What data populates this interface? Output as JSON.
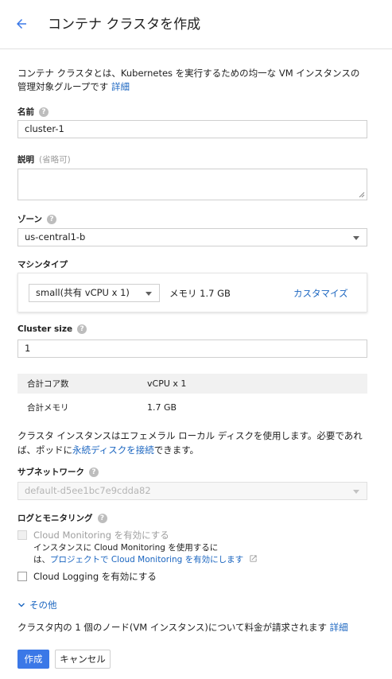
{
  "header": {
    "title": "コンテナ クラスタを作成"
  },
  "intro": {
    "text": "コンテナ クラスタとは、Kubernetes を実行するための均一な VM インスタンスの管理対象グループです ",
    "link": "詳細"
  },
  "name": {
    "label": "名前",
    "value": "cluster-1"
  },
  "description": {
    "label": "説明",
    "optional": "(省略可)",
    "value": ""
  },
  "zone": {
    "label": "ゾーン",
    "value": "us-central1-b"
  },
  "machine_type": {
    "label": "マシンタイプ",
    "value": "small(共有 vCPU x 1)",
    "memory": "メモリ 1.7 GB",
    "customize": "カスタマイズ"
  },
  "cluster_size": {
    "label": "Cluster size",
    "value": "1"
  },
  "summary": {
    "rows": [
      {
        "key": "合計コア数",
        "value": "vCPU x 1"
      },
      {
        "key": "合計メモリ",
        "value": "1.7 GB"
      }
    ]
  },
  "ephemeral": {
    "text_before": "クラスタ インスタンスはエフェメラル ローカル ディスクを使用します。必要であれば、ポッドに",
    "link": "永続ディスクを接続",
    "text_after": "できます。"
  },
  "subnetwork": {
    "label": "サブネットワーク",
    "value": "default-d5ee1bc7e9cdda82"
  },
  "logging": {
    "label": "ログとモニタリング",
    "monitoring_label": "Cloud Monitoring を有効にする",
    "note_line1": "インスタンスに Cloud Monitoring を使用するに",
    "note_prefix": "は、",
    "note_link": "プロジェクトで Cloud Monitoring を有効にします",
    "logging_label": "Cloud Logging を有効にする"
  },
  "other": {
    "label": "その他"
  },
  "billing": {
    "text": "クラスタ内の 1 個のノード(VM インスタンス)について料金が請求されます ",
    "link": "詳細"
  },
  "actions": {
    "create": "作成",
    "cancel": "キャンセル"
  },
  "colors": {
    "primary": "#3b78e7",
    "link": "#1a65c0"
  }
}
